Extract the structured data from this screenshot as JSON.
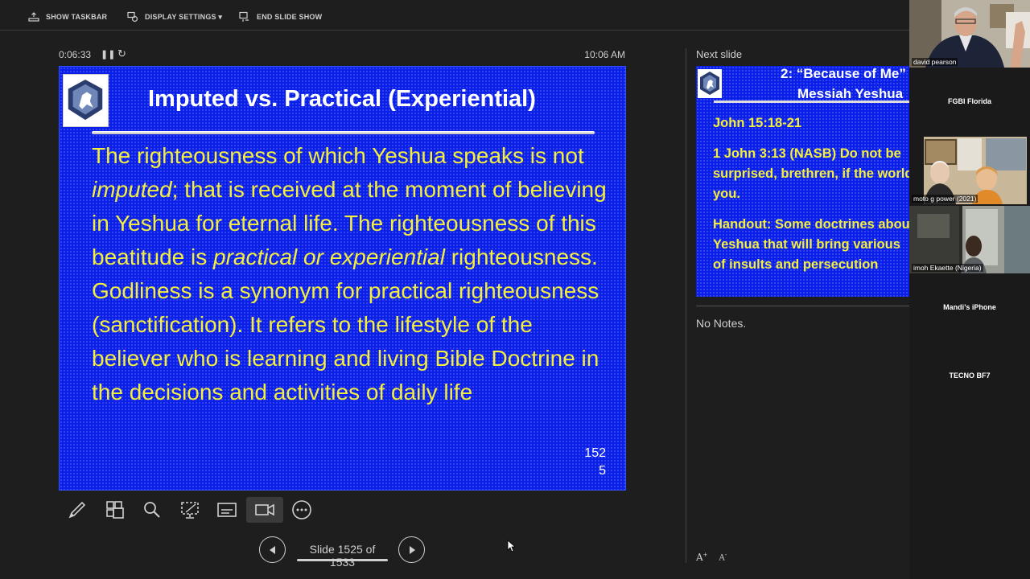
{
  "toolbar": {
    "show_taskbar": "SHOW TASKBAR",
    "display_settings": "DISPLAY SETTINGS ▾",
    "end_slide_show": "END SLIDE SHOW"
  },
  "presenter": {
    "timer": "0:06:33",
    "clock": "10:06 AM"
  },
  "current_slide": {
    "title": "Imputed vs. Practical (Experiential)",
    "body_part1": "The righteousness of which Yeshua speaks is not ",
    "body_italic1": "imputed",
    "body_part2": "; that is received at the moment of believing in Yeshua for eternal life. The righteousness of this beatitude is ",
    "body_italic2": "practical or experiential",
    "body_part3": " righteousness. Godliness is a synonym for practical righteousness (sanctification). It refers to the lifestyle of the believer who is learning and living Bible Doctrine in the decisions and activities of daily life",
    "number_line1": "152",
    "number_line2": "5"
  },
  "navigation": {
    "counter": "Slide 1525 of 1533"
  },
  "next_slide": {
    "label": "Next slide",
    "title_line1": "2: “Because of Me”",
    "title_line2": "Messiah Yeshua",
    "ref": "John 15:18-21",
    "verse_line1": "1 John 3:13 (NASB) Do not be",
    "verse_line2": "surprised, brethren, if the world",
    "verse_line3": "you.",
    "handout_line1": "Handout: Some doctrines about",
    "handout_line2": "Yeshua that will bring various",
    "handout_line3": "of insults and persecution"
  },
  "notes": {
    "text": "No Notes."
  },
  "participants": [
    {
      "name": "david pearson"
    },
    {
      "name": "FGBI Florida"
    },
    {
      "name": "moto g power (2021)"
    },
    {
      "name": "imoh Ekaette (Nigeria)"
    },
    {
      "name": "Mandi’s iPhone"
    },
    {
      "name": "TECNO BF7"
    }
  ],
  "colors": {
    "slide_bg": "#0a1fe8",
    "slide_text": "#f4ee3c",
    "active_speaker_border": "#e8c04a"
  }
}
